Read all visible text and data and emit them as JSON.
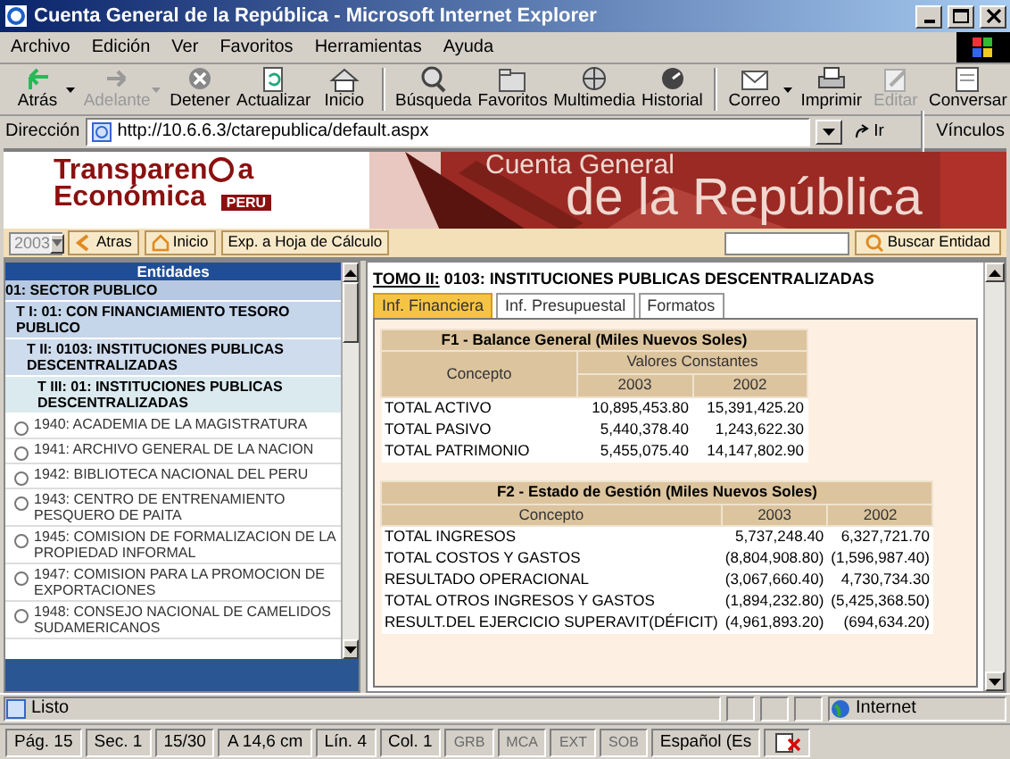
{
  "window": {
    "title": "Cuenta General de la República - Microsoft Internet Explorer"
  },
  "menu": [
    "Archivo",
    "Edición",
    "Ver",
    "Favoritos",
    "Herramientas",
    "Ayuda"
  ],
  "toolbar": [
    {
      "label": "Atrás",
      "disabled": false,
      "dropdown": true
    },
    {
      "label": "Adelante",
      "disabled": true,
      "dropdown": true
    },
    {
      "label": "Detener",
      "disabled": false,
      "dropdown": false
    },
    {
      "label": "Actualizar",
      "disabled": false,
      "dropdown": false
    },
    {
      "label": "Inicio",
      "disabled": false,
      "dropdown": false
    },
    {
      "label": "Búsqueda",
      "disabled": false,
      "dropdown": false
    },
    {
      "label": "Favoritos",
      "disabled": false,
      "dropdown": false
    },
    {
      "label": "Multimedia",
      "disabled": false,
      "dropdown": false
    },
    {
      "label": "Historial",
      "disabled": false,
      "dropdown": false
    },
    {
      "label": "Correo",
      "disabled": false,
      "dropdown": true
    },
    {
      "label": "Imprimir",
      "disabled": false,
      "dropdown": false
    },
    {
      "label": "Editar",
      "disabled": true,
      "dropdown": false
    },
    {
      "label": "Conversar",
      "disabled": false,
      "dropdown": false
    }
  ],
  "address": {
    "label": "Dirección",
    "url": "http://10.6.6.3/ctarepublica/default.aspx",
    "go": "Ir",
    "links": "Vínculos"
  },
  "banner": {
    "logo_start": "Transparen",
    "logo_end": "a",
    "logo_line2": "Económica",
    "logo_badge": "PERU",
    "title_small": "Cuenta General",
    "title_large": "de la República"
  },
  "nav": {
    "year": "2003",
    "buttons": [
      "Atras",
      "Inicio"
    ],
    "export": "Exp. a Hoja de Cálculo",
    "search_button": "Buscar Entidad"
  },
  "entities": {
    "header": "Entidades",
    "tree": [
      {
        "label": "01: SECTOR PUBLICO",
        "children": [
          {
            "label": "T I: 01: CON FINANCIAMIENTO TESORO PUBLICO",
            "children": [
              {
                "label": "T II: 0103: INSTITUCIONES PUBLICAS DESCENTRALIZADAS",
                "children": [
                  {
                    "label": "T III: 01: INSTITUCIONES PUBLICAS DESCENTRALIZADAS",
                    "children": [
                      {
                        "label": "1940: ACADEMIA DE LA MAGISTRATURA",
                        "selected": false
                      },
                      {
                        "label": "1941: ARCHIVO GENERAL DE LA NACION",
                        "selected": false
                      },
                      {
                        "label": "1942: BIBLIOTECA NACIONAL DEL PERU",
                        "selected": false
                      },
                      {
                        "label": "1943: CENTRO DE ENTRENAMIENTO PESQUERO DE PAITA",
                        "selected": false
                      },
                      {
                        "label": "1945: COMISION DE FORMALIZACION DE LA PROPIEDAD INFORMAL",
                        "selected": false
                      },
                      {
                        "label": "1947: COMISION PARA LA PROMOCION DE EXPORTACIONES",
                        "selected": false
                      },
                      {
                        "label": "1948: CONSEJO NACIONAL DE CAMELIDOS SUDAMERICANOS",
                        "selected": false
                      }
                    ]
                  }
                ]
              }
            ]
          }
        ]
      }
    ]
  },
  "detail": {
    "title_prefix": "TOMO II:",
    "title": "0103: INSTITUCIONES PUBLICAS DESCENTRALIZADAS",
    "tabs": [
      {
        "label": "Inf. Financiera",
        "selected": true
      },
      {
        "label": "Inf. Presupuestal",
        "selected": false
      },
      {
        "label": "Formatos",
        "selected": false
      }
    ],
    "balance": {
      "title": "F1 - Balance General (Miles Nuevos Soles)",
      "concept": "Concepto",
      "group": "Valores Constantes",
      "years": [
        "2003",
        "2002"
      ],
      "rows": [
        [
          "TOTAL ACTIVO",
          "10,895,453.80",
          "15,391,425.20"
        ],
        [
          "TOTAL PASIVO",
          "5,440,378.40",
          "1,243,622.30"
        ],
        [
          "TOTAL PATRIMONIO",
          "5,455,075.40",
          "14,147,802.90"
        ]
      ]
    },
    "gestion": {
      "title": "F2 - Estado de Gestión (Miles Nuevos Soles)",
      "concept": "Concepto",
      "years": [
        "2003",
        "2002"
      ],
      "rows": [
        [
          "TOTAL INGRESOS",
          "5,737,248.40",
          "6,327,721.70"
        ],
        [
          "TOTAL COSTOS Y GASTOS",
          "(8,804,908.80)",
          "(1,596,987.40)"
        ],
        [
          "RESULTADO OPERACIONAL",
          "(3,067,660.40)",
          "4,730,734.30"
        ],
        [
          "TOTAL OTROS INGRESOS Y GASTOS",
          "(1,894,232.80)",
          "(5,425,368.50)"
        ],
        [
          "RESULT.DEL EJERCICIO SUPERAVIT(DÉFICIT)",
          "(4,961,893.20)",
          "(694,634.20)"
        ]
      ]
    }
  },
  "status": {
    "text": "Listo",
    "zone": "Internet"
  },
  "word_status": [
    {
      "label": "Pág. 15",
      "disabled": false
    },
    {
      "label": "Sec. 1",
      "disabled": false
    },
    {
      "label": "15/30",
      "disabled": false
    },
    {
      "label": "A  14,6 cm",
      "disabled": false
    },
    {
      "label": "Lín. 4",
      "disabled": false
    },
    {
      "label": "Col. 1",
      "disabled": false
    },
    {
      "label": "GRB",
      "disabled": true
    },
    {
      "label": "MCA",
      "disabled": true
    },
    {
      "label": "EXT",
      "disabled": true
    },
    {
      "label": "SOB",
      "disabled": true
    },
    {
      "label": "Español (Es",
      "disabled": false
    }
  ]
}
